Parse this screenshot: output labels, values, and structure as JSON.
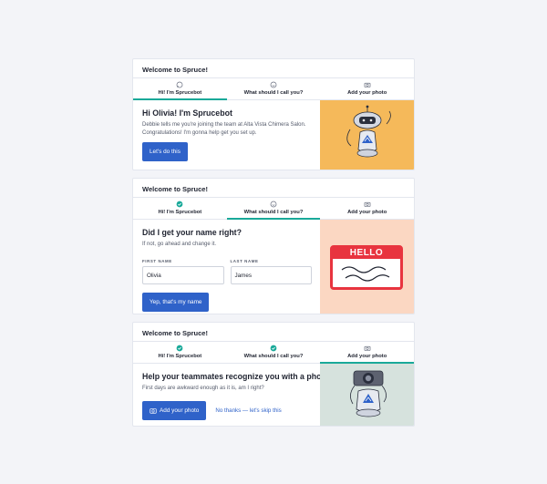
{
  "cards": [
    {
      "header": "Welcome to Spruce!",
      "tabs": [
        "Hi! I'm Sprucebot",
        "What should I call you?",
        "Add your photo"
      ],
      "title": "Hi Olivia! I'm Sprucebot",
      "desc": "Debbie tells me you're joining the team at Alta Vista Chimera Salon. Congratulations! I'm gonna help get you set up.",
      "button": "Let's do this",
      "panel_color": "#f5b95a"
    },
    {
      "header": "Welcome to Spruce!",
      "tabs": [
        "Hi! I'm Sprucebot",
        "What should I call you?",
        "Add your photo"
      ],
      "title": "Did I get your name right?",
      "desc": "If not, go ahead and change it.",
      "first_name_label": "FIRST NAME",
      "first_name_value": "Olivia",
      "last_name_label": "LAST NAME",
      "last_name_value": "James",
      "button": "Yep, that's my name",
      "badge_text": "HELLO",
      "panel_color": "#fbd7c2"
    },
    {
      "header": "Welcome to Spruce!",
      "tabs": [
        "Hi! I'm Sprucebot",
        "What should I call you?",
        "Add your photo"
      ],
      "title": "Help your teammates recognize you with a photo",
      "desc": "First days are awkward enough as it is, am I right?",
      "button": "Add your photo",
      "link": "No thanks — let's skip this",
      "panel_color": "#d6e2dd"
    }
  ],
  "colors": {
    "accent": "#19a999",
    "primary": "#2f62c9"
  }
}
